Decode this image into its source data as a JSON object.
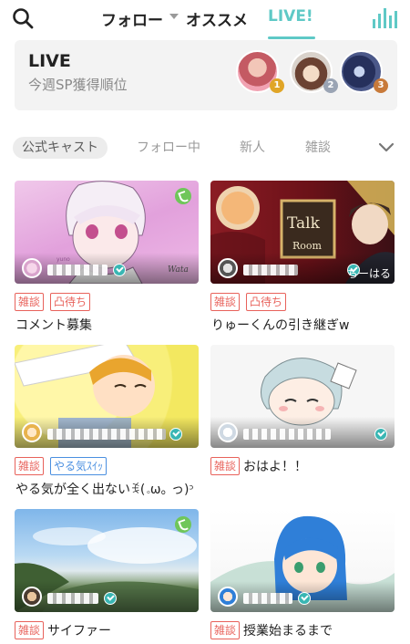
{
  "nav": {
    "tabs": [
      {
        "label": "フォロー"
      },
      {
        "label": "オススメ"
      },
      {
        "label": "LIVE!"
      }
    ],
    "active_color": "#5fc9c6",
    "search_icon": "search-icon",
    "ranking_icon": "bar-chart-icon"
  },
  "ranking": {
    "title": "LIVE",
    "subtitle": "今週SP獲得順位",
    "ranks": [
      "1",
      "2",
      "3"
    ]
  },
  "categories": {
    "items": [
      "公式キャスト",
      "フォロー中",
      "新人",
      "雑談"
    ],
    "active": "公式キャスト",
    "more_icon": "chevron-down-icon"
  },
  "streams": [
    {
      "tags": [
        {
          "label": "雑談",
          "color": "red"
        },
        {
          "label": "凸待ち",
          "color": "red"
        }
      ],
      "title": "コメント募集",
      "overlay": "",
      "call": true
    },
    {
      "tags": [
        {
          "label": "雑談",
          "color": "red"
        },
        {
          "label": "凸待ち",
          "color": "red"
        }
      ],
      "title": "りゅーくんの引き継ぎw",
      "overlay": "ちーはる",
      "call": false
    },
    {
      "tags": [
        {
          "label": "雑談",
          "color": "red"
        },
        {
          "label": "やる気ｽｲｯ",
          "color": "blue"
        }
      ],
      "title": "やる気が全く出ないꉂ(｡ω｡ っ)ᵓ",
      "overlay": "",
      "call": false
    },
    {
      "tags": [
        {
          "label": "雑談",
          "color": "red"
        }
      ],
      "title": "おはよ！！",
      "overlay": "",
      "call": false
    },
    {
      "tags": [
        {
          "label": "雑談",
          "color": "red"
        }
      ],
      "title": "サイファー",
      "overlay": "",
      "call": true
    },
    {
      "tags": [
        {
          "label": "雑談",
          "color": "red"
        }
      ],
      "title": "授業始まるまで",
      "overlay": "",
      "call": false
    }
  ],
  "thumb2_sign": {
    "line1": "Talk",
    "line2": "Room"
  }
}
